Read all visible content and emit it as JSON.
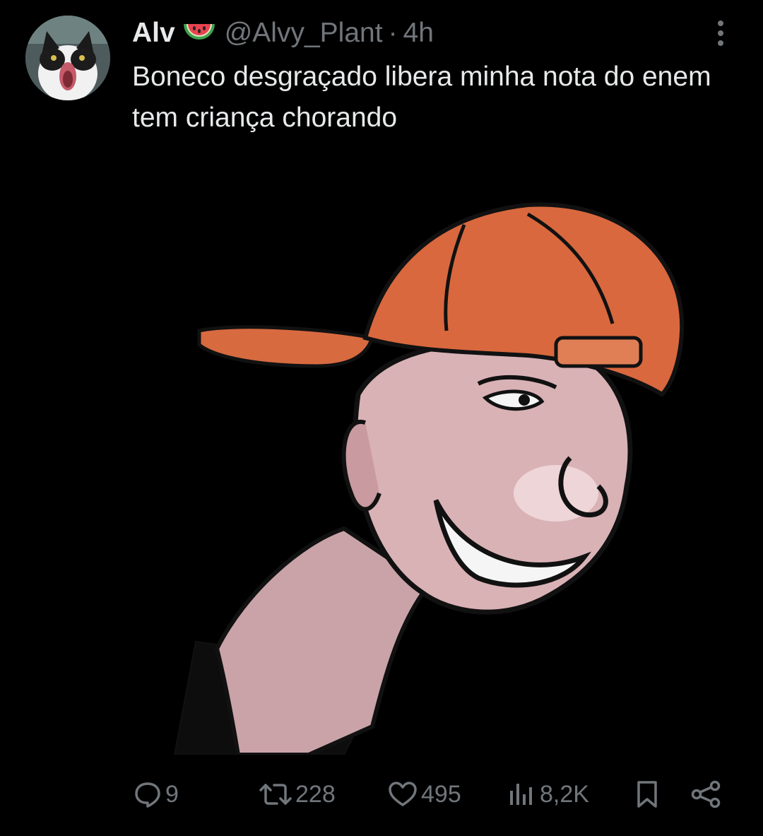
{
  "user": {
    "display_name": "Alv",
    "emoji_icon": "watermelon-icon",
    "handle": "@Alvy_Plant",
    "separator": "·",
    "time": "4h"
  },
  "tweet": {
    "text": "Boneco desgraçado libera minha nota do enem tem criança chorando"
  },
  "media": {
    "icon": "meme-image-cap-guy"
  },
  "actions": {
    "replies": "9",
    "retweets": "228",
    "likes": "495",
    "views": "8,2K"
  },
  "colors": {
    "background": "#000000",
    "text_primary": "#e7e9ea",
    "text_secondary": "#71767b"
  }
}
